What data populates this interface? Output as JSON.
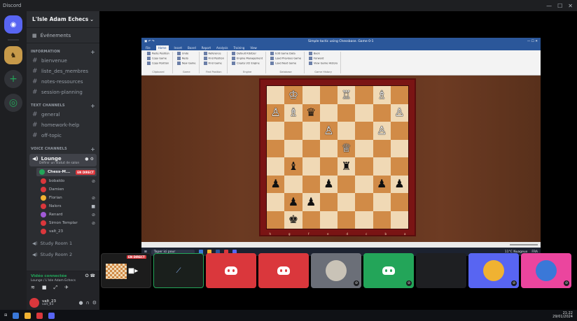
{
  "window": {
    "title": "Discord",
    "controls": [
      "—",
      "☐",
      "✕"
    ]
  },
  "server": {
    "name": "L'Isle Adam Echecs",
    "events_label": "Événements",
    "categories": [
      {
        "label": "INFORMATION",
        "channels": [
          "bienvenue",
          "liste_des_membres",
          "notes-ressources",
          "session-planning"
        ]
      },
      {
        "label": "TEXT CHANNELS",
        "channels": [
          "general",
          "homework-help",
          "off-topic"
        ]
      },
      {
        "label": "VOICE CHANNELS"
      }
    ]
  },
  "lounge": {
    "name": "Lounge",
    "status": "Définir un statut de salon",
    "users": [
      {
        "name": "Chess-M...",
        "color": "#23a559",
        "live": "EN DIRECT"
      },
      {
        "name": "bobaldo",
        "color": "#da373c"
      },
      {
        "name": "Damien",
        "color": "#da373c"
      },
      {
        "name": "Florian",
        "color": "#f0b232"
      },
      {
        "name": "Nalors",
        "color": "#da373c"
      },
      {
        "name": "Renard",
        "color": "#a05ad6"
      },
      {
        "name": "Simon Templar",
        "color": "#da373c"
      },
      {
        "name": "valt_23",
        "color": "#da373c"
      }
    ]
  },
  "voice_channels": [
    "Study Room 1",
    "Study Room 2"
  ],
  "voice_panel": {
    "status": "Vidéo connectée",
    "location": "Lounge / L'Isle Adam Echecs"
  },
  "user": {
    "name": "valt_23",
    "tag": "valt_23"
  },
  "chessbase": {
    "title": "Simple tactic using Chessbase. Game 0-1",
    "tabs": [
      "File",
      "Home",
      "Insert",
      "Board",
      "Report",
      "Analysis",
      "Training",
      "View"
    ],
    "ribbon_groups": [
      {
        "name": "Clipboard",
        "items": [
          "Paste Position",
          "Copy Game",
          "Copy Position"
        ]
      },
      {
        "name": "Game",
        "items": [
          "Undo",
          "Redo",
          "New Game"
        ]
      },
      {
        "name": "Find Position",
        "items": [
          "Reference",
          "Find Position",
          "Find Game"
        ]
      },
      {
        "name": "Engine",
        "items": [
          "Default Kibitzer",
          "Engine Management",
          "Create UCI Engine"
        ]
      },
      {
        "name": "Database",
        "items": [
          "Edit Game Data",
          "Load Previous Game",
          "Load Next Game"
        ]
      },
      {
        "name": "Game History",
        "items": [
          "Back",
          "Forward",
          "View Game History"
        ]
      }
    ],
    "files": [
      "h",
      "g",
      "f",
      "e",
      "d",
      "c",
      "b",
      "a"
    ],
    "board": [
      [
        "",
        "♔",
        "",
        "",
        "♖",
        "",
        "♗",
        ""
      ],
      [
        "♙",
        "♗",
        "♛",
        "",
        "",
        "",
        "",
        "♙"
      ],
      [
        "",
        "",
        "",
        "♙",
        "",
        "",
        "♙",
        ""
      ],
      [
        "",
        "",
        "",
        "",
        "♕",
        "",
        "",
        ""
      ],
      [
        "",
        "♝",
        "",
        "",
        "♜",
        "",
        "",
        ""
      ],
      [
        "♟",
        "",
        "",
        "♟",
        "",
        "",
        "♟",
        "♟"
      ],
      [
        "",
        "♟",
        "♟",
        "",
        "",
        "",
        "",
        ""
      ],
      [
        "",
        "♚",
        "",
        "",
        "",
        "",
        "",
        ""
      ]
    ],
    "taskbar_search": "Taper ici pour",
    "weather": "11°C Nuageux",
    "lang": "FRA"
  },
  "tiles": [
    {
      "type": "stream",
      "badge": "EN DIRECT"
    },
    {
      "type": "stream2"
    },
    {
      "type": "red"
    },
    {
      "type": "red"
    },
    {
      "type": "avatar"
    },
    {
      "type": "green"
    },
    {
      "type": "dark"
    },
    {
      "type": "avatar2"
    },
    {
      "type": "avatar3"
    }
  ],
  "clock": {
    "time": "21:22",
    "date": "29/01/2024"
  }
}
